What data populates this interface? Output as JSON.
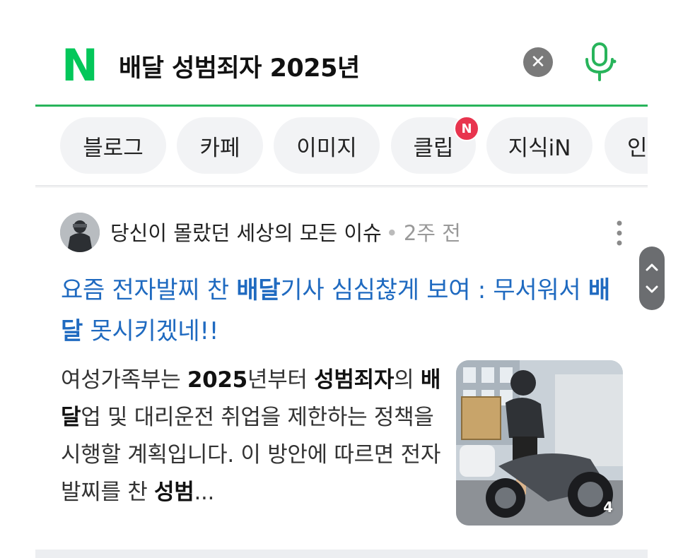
{
  "search": {
    "logo_letter": "N",
    "query": "배달 성범죄자 2025년",
    "brand_color": "#03c75a"
  },
  "tabs": [
    {
      "label": "블로그"
    },
    {
      "label": "카페"
    },
    {
      "label": "이미지"
    },
    {
      "label": "클립",
      "badge": "N"
    },
    {
      "label": "지식iN"
    },
    {
      "label": "인"
    }
  ],
  "result": {
    "source_name": "당신이 몰랐던 세상의 모든 이슈",
    "time_ago": "2주 전",
    "title_parts": [
      "요즘 전자발찌 찬 ",
      "배달",
      "기사 심심찮게 보여 : 무서워서 ",
      "배달",
      " 못시키겠네!!"
    ],
    "snippet_parts": [
      "여성가족부는 ",
      "2025",
      "년부터 ",
      "성범죄자",
      "의 ",
      "배달",
      "업 및 대리운전 취업을 제한하는 정책을 시행할 계획입니다. 이 방안에 따르면 전자발찌를 찬 ",
      "성범",
      "..."
    ],
    "thumbnail_count": "4",
    "link_color": "#1f6ac0"
  }
}
